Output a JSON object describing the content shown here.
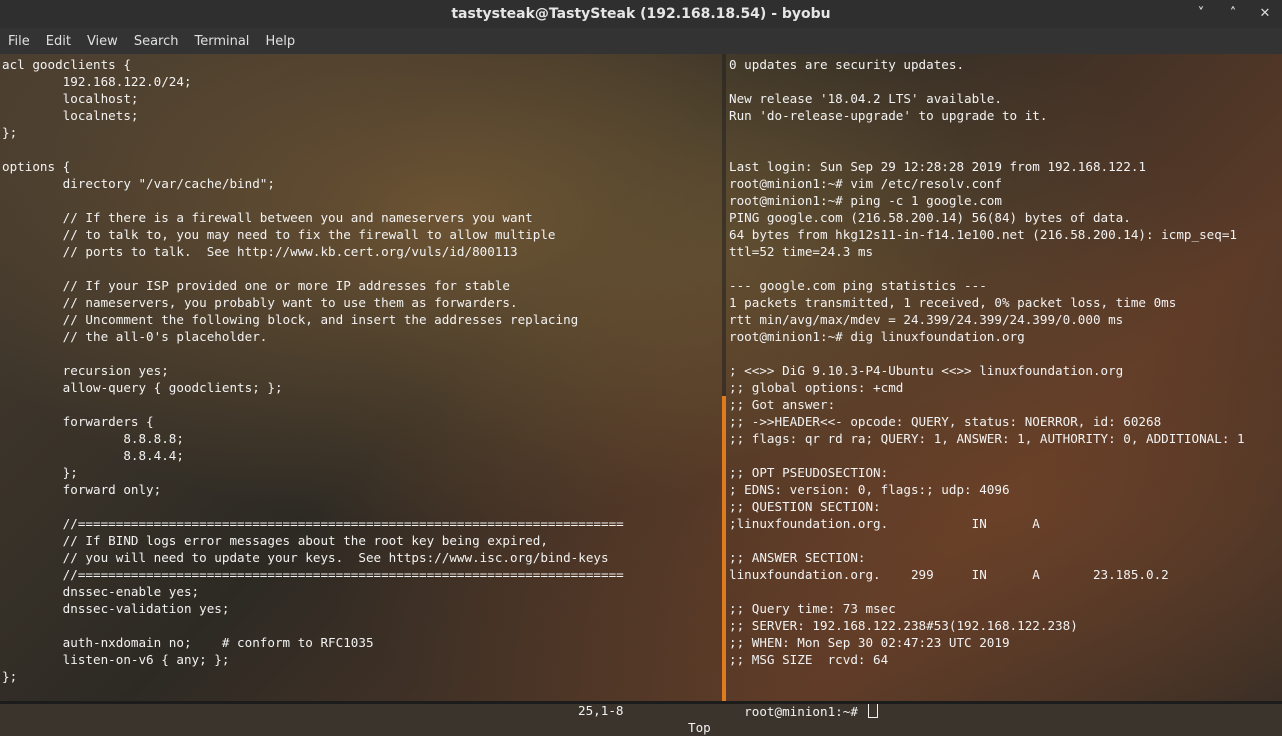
{
  "window": {
    "title": "tastysteak@TastySteak (192.168.18.54) - byobu",
    "minimize_label": "˅",
    "restore_label": "˄",
    "close_label": "✕"
  },
  "menu": [
    "File",
    "Edit",
    "View",
    "Search",
    "Terminal",
    "Help"
  ],
  "left_pane": {
    "lines": [
      "acl goodclients {",
      "        192.168.122.0/24;",
      "        localhost;",
      "        localnets;",
      "};",
      "",
      "options {",
      "        directory \"/var/cache/bind\";",
      "",
      "        // If there is a firewall between you and nameservers you want",
      "        // to talk to, you may need to fix the firewall to allow multiple",
      "        // ports to talk.  See http://www.kb.cert.org/vuls/id/800113",
      "",
      "        // If your ISP provided one or more IP addresses for stable",
      "        // nameservers, you probably want to use them as forwarders.",
      "        // Uncomment the following block, and insert the addresses replacing",
      "        // the all-0's placeholder.",
      "",
      "        recursion yes;",
      "        allow-query { goodclients; };",
      "",
      "        forwarders {",
      "                8.8.8.8;",
      "                8.8.4.4;",
      "        };",
      "        forward only;",
      "",
      "        //========================================================================",
      "        // If BIND logs error messages about the root key being expired,",
      "        // you will need to update your keys.  See https://www.isc.org/bind-keys",
      "        //========================================================================",
      "        dnssec-enable yes;",
      "        dnssec-validation yes;",
      "",
      "        auth-nxdomain no;    # conform to RFC1035",
      "        listen-on-v6 { any; };",
      "};"
    ],
    "status_position": "25,1-8",
    "status_scroll": "Top"
  },
  "right_pane": {
    "lines": [
      "0 updates are security updates.",
      "",
      "New release '18.04.2 LTS' available.",
      "Run 'do-release-upgrade' to upgrade to it.",
      "",
      "",
      "Last login: Sun Sep 29 12:28:28 2019 from 192.168.122.1",
      "root@minion1:~# vim /etc/resolv.conf",
      "root@minion1:~# ping -c 1 google.com",
      "PING google.com (216.58.200.14) 56(84) bytes of data.",
      "64 bytes from hkg12s11-in-f14.1e100.net (216.58.200.14): icmp_seq=1",
      "ttl=52 time=24.3 ms",
      "",
      "--- google.com ping statistics ---",
      "1 packets transmitted, 1 received, 0% packet loss, time 0ms",
      "rtt min/avg/max/mdev = 24.399/24.399/24.399/0.000 ms",
      "root@minion1:~# dig linuxfoundation.org",
      "",
      "; <<>> DiG 9.10.3-P4-Ubuntu <<>> linuxfoundation.org",
      ";; global options: +cmd",
      ";; Got answer:",
      ";; ->>HEADER<<- opcode: QUERY, status: NOERROR, id: 60268",
      ";; flags: qr rd ra; QUERY: 1, ANSWER: 1, AUTHORITY: 0, ADDITIONAL: 1",
      "",
      ";; OPT PSEUDOSECTION:",
      "; EDNS: version: 0, flags:; udp: 4096",
      ";; QUESTION SECTION:",
      ";linuxfoundation.org.           IN      A",
      "",
      ";; ANSWER SECTION:",
      "linuxfoundation.org.    299     IN      A       23.185.0.2",
      "",
      ";; Query time: 73 msec",
      ";; SERVER: 192.168.122.238#53(192.168.122.238)",
      ";; WHEN: Mon Sep 30 02:47:23 UTC 2019",
      ";; MSG SIZE  rcvd: 64",
      ""
    ],
    "prompt": "root@minion1:~# "
  },
  "colors": {
    "accent_divider": "#e07a1f",
    "terminal_text": "#f2f2f2",
    "titlebar": "#2f2f2f"
  }
}
